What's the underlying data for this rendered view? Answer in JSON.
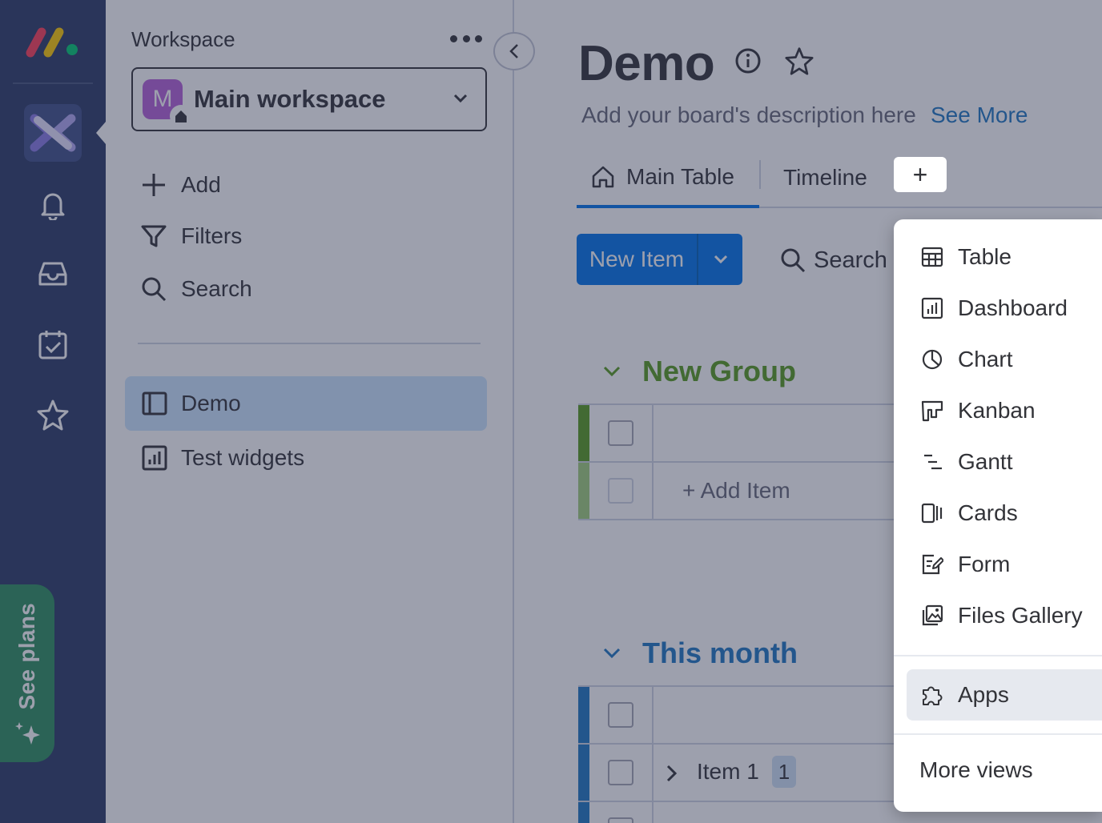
{
  "colors": {
    "rail_bg": "#2b3a67",
    "primary": "#0073ea",
    "group_green": "#579b1e",
    "group_blue": "#1f76c2",
    "see_plans_bg": "#2e8f5e",
    "active_board": "#cce5ff"
  },
  "rail": {
    "icons": [
      "monday-logo-icon",
      "workspace-app-icon",
      "bell-icon",
      "inbox-icon",
      "calendar-check-icon",
      "star-icon"
    ],
    "see_plans_label": "See plans"
  },
  "workspace_panel": {
    "label": "Workspace",
    "selected_workspace": {
      "avatar_letter": "M",
      "name": "Main workspace"
    },
    "actions": [
      {
        "icon": "plus-icon",
        "label": "Add"
      },
      {
        "icon": "filter-icon",
        "label": "Filters"
      },
      {
        "icon": "search-icon",
        "label": "Search"
      }
    ],
    "boards": [
      {
        "icon": "board-icon",
        "label": "Demo",
        "active": true
      },
      {
        "icon": "dashboard-icon",
        "label": "Test widgets",
        "active": false
      }
    ]
  },
  "board": {
    "title": "Demo",
    "description": "Add your board's description here",
    "see_more": "See More",
    "tabs": [
      {
        "label": "Main Table",
        "icon": "home-icon",
        "active": true
      },
      {
        "label": "Timeline",
        "active": false
      }
    ],
    "add_view_symbol": "+",
    "new_item_label": "New Item",
    "search_label": "Search",
    "groups": [
      {
        "name": "New Group",
        "color": "#579b1e",
        "add_item_label": "+ Add Item"
      },
      {
        "name": "This month",
        "color": "#1f76c2",
        "items": [
          {
            "name": "Item 1",
            "subitems_count": "1"
          }
        ]
      }
    ]
  },
  "views_menu": {
    "items": [
      {
        "icon": "table-icon",
        "label": "Table"
      },
      {
        "icon": "dashboard-icon",
        "label": "Dashboard"
      },
      {
        "icon": "chart-icon",
        "label": "Chart"
      },
      {
        "icon": "kanban-icon",
        "label": "Kanban"
      },
      {
        "icon": "gantt-icon",
        "label": "Gantt"
      },
      {
        "icon": "cards-icon",
        "label": "Cards"
      },
      {
        "icon": "form-icon",
        "label": "Form"
      },
      {
        "icon": "gallery-icon",
        "label": "Files Gallery"
      }
    ],
    "apps_label": "Apps",
    "more_views_label": "More views"
  }
}
